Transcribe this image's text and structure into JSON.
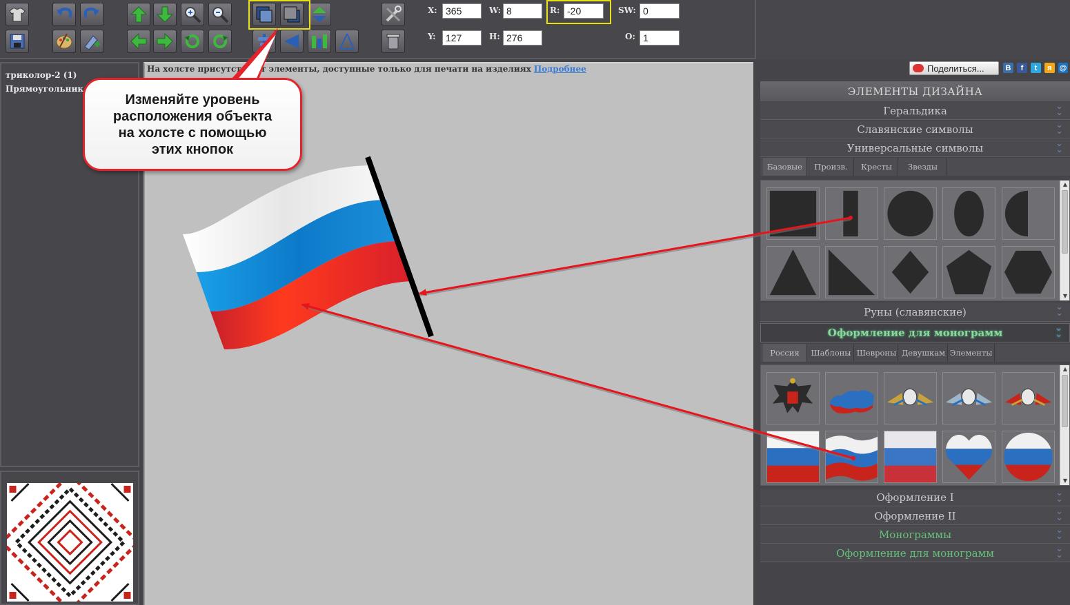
{
  "toolbar": {
    "fields": {
      "x_label": "X:",
      "x_value": "365",
      "y_label": "Y:",
      "y_value": "127",
      "w_label": "W:",
      "w_value": "8",
      "h_label": "H:",
      "h_value": "276",
      "r_label": "R:",
      "r_value": "-20",
      "sw_label": "SW:",
      "sw_value": "0",
      "o_label": "O:",
      "o_value": "1"
    }
  },
  "layers": {
    "items": [
      "триколор-2 (1)",
      "Прямоугольник ("
    ]
  },
  "canvas": {
    "notice_text": "На холсте присутствуют элементы, доступные только для печати на изделиях",
    "notice_link": "Подробнее"
  },
  "callout": {
    "text": "Изменяйте уровень\nрасположения объекта\nна холсте с помощью\nэтих кнопок"
  },
  "share": {
    "label": "Поделиться...",
    "networks": [
      "В",
      "f",
      "t",
      "я",
      "@"
    ]
  },
  "design_panel": {
    "title": "ЭЛЕМЕНТЫ ДИЗАЙНА",
    "categories": {
      "heraldry": "Геральдика",
      "slavic_symbols": "Славянские символы",
      "universal_symbols": "Универсальные символы",
      "runes": "Руны (славянские)",
      "monogram_design": "Оформление для монограмм",
      "design1": "Оформление I",
      "design2": "Оформление II",
      "monograms": "Монограммы",
      "monogram_design2": "Оформление для монограмм"
    },
    "universal_tabs": [
      "Базовые",
      "Произв.",
      "Кресты",
      "Звезды"
    ],
    "monogram_tabs": [
      "Россия",
      "Шаблоны",
      "Шевроны",
      "Девушкам",
      "Элементы"
    ]
  },
  "colors": {
    "accent_red": "#e5232d",
    "highlight_yellow": "#e8e01a",
    "flag_white": "#ffffff",
    "flag_blue": "#1c86d4",
    "flag_red": "#e8262a"
  },
  "icons": {
    "toolbar": [
      "tshirt-icon",
      "save-icon",
      "undo-icon",
      "redo-icon",
      "palette-icon",
      "add-image-icon",
      "move-up-icon",
      "move-down-icon",
      "move-left-icon",
      "move-right-icon",
      "zoom-in-icon",
      "zoom-out-icon",
      "rotate-ccw-icon",
      "rotate-cw-icon",
      "bring-forward-icon",
      "send-backward-icon",
      "flip-vertical-icon",
      "flip-horizontal-icon",
      "align-icon",
      "perspective-icon",
      "tools-icon",
      "trash-icon"
    ]
  }
}
